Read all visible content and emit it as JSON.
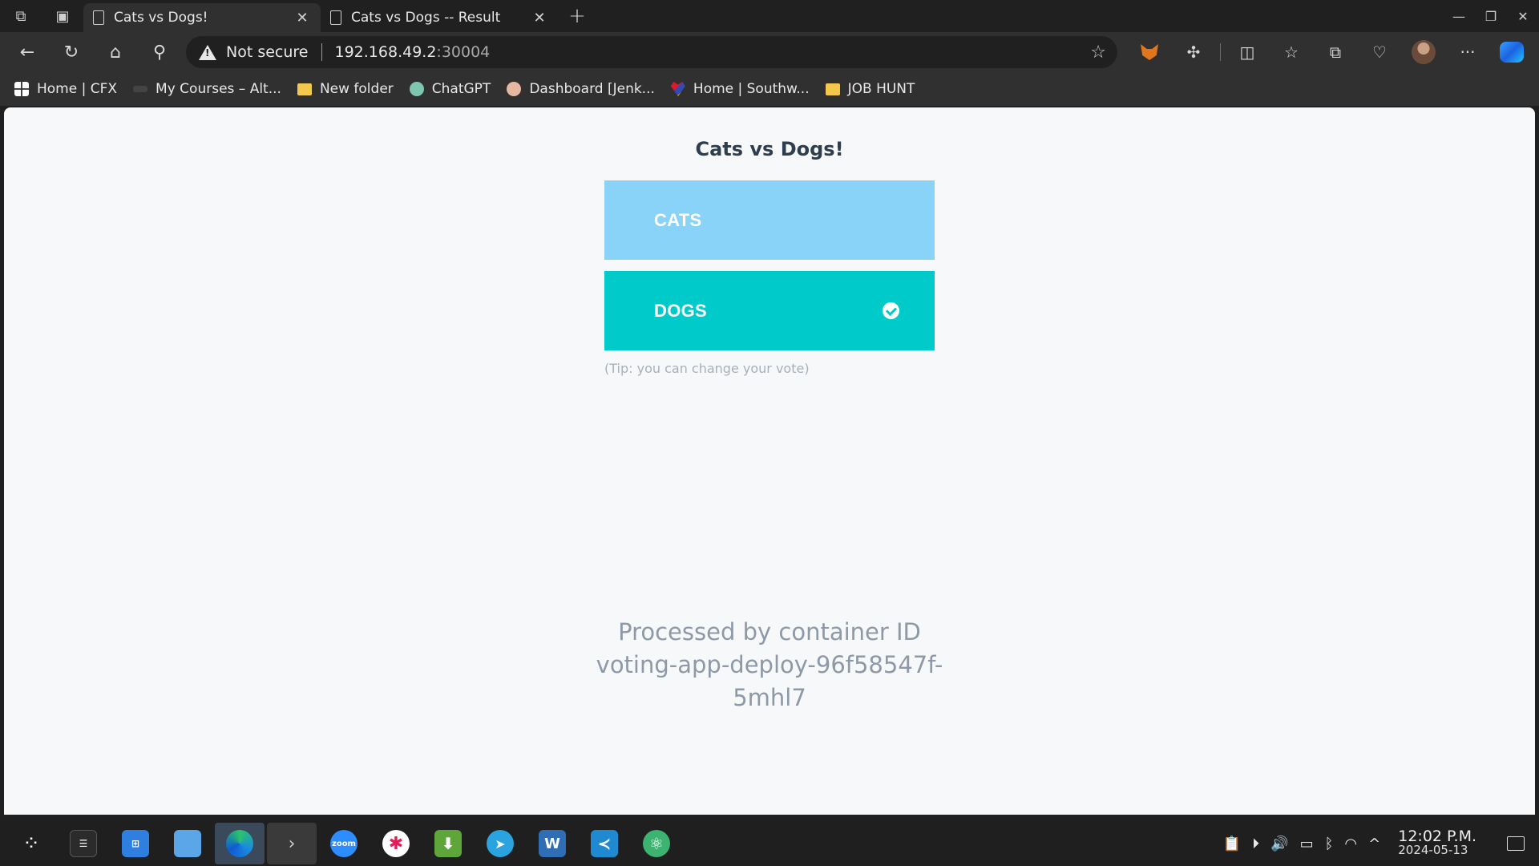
{
  "browser": {
    "tabs": [
      {
        "title": "Cats vs Dogs!",
        "active": true
      },
      {
        "title": "Cats vs Dogs -- Result",
        "active": false
      }
    ],
    "address": {
      "security_label": "Not secure",
      "host": "192.168.49.2",
      "port": ":30004"
    },
    "bookmarks": [
      {
        "label": "Home | CFX",
        "icon": "cfx-icon"
      },
      {
        "label": "My Courses – Alt...",
        "icon": "courses-icon"
      },
      {
        "label": "New folder",
        "icon": "folder-icon"
      },
      {
        "label": "ChatGPT",
        "icon": "chatgpt-icon"
      },
      {
        "label": "Dashboard [Jenk...",
        "icon": "jenkins-icon"
      },
      {
        "label": "Home | Southw...",
        "icon": "southwest-icon"
      },
      {
        "label": "JOB HUNT",
        "icon": "folder-icon"
      }
    ]
  },
  "page": {
    "title": "Cats vs Dogs!",
    "options": [
      {
        "label": "CATS",
        "color": "#89d2f8",
        "selected": false
      },
      {
        "label": "DOGS",
        "color": "#00cbca",
        "selected": true
      }
    ],
    "tip": "(Tip: you can change your vote)",
    "processed_line1": "Processed by container ID",
    "processed_line2": "voting-app-deploy-96f58547f-",
    "processed_line3": "5mhl7"
  },
  "taskbar": {
    "apps": [
      "start-icon",
      "settings-icon",
      "store-icon",
      "file-explorer-icon",
      "edge-icon",
      "terminal-icon",
      "zoom-icon",
      "slack-icon",
      "download-manager-icon",
      "telegram-icon",
      "word-icon",
      "vscode-icon",
      "atom-icon"
    ],
    "time": "12:02 P.M.",
    "date": "2024-05-13"
  }
}
